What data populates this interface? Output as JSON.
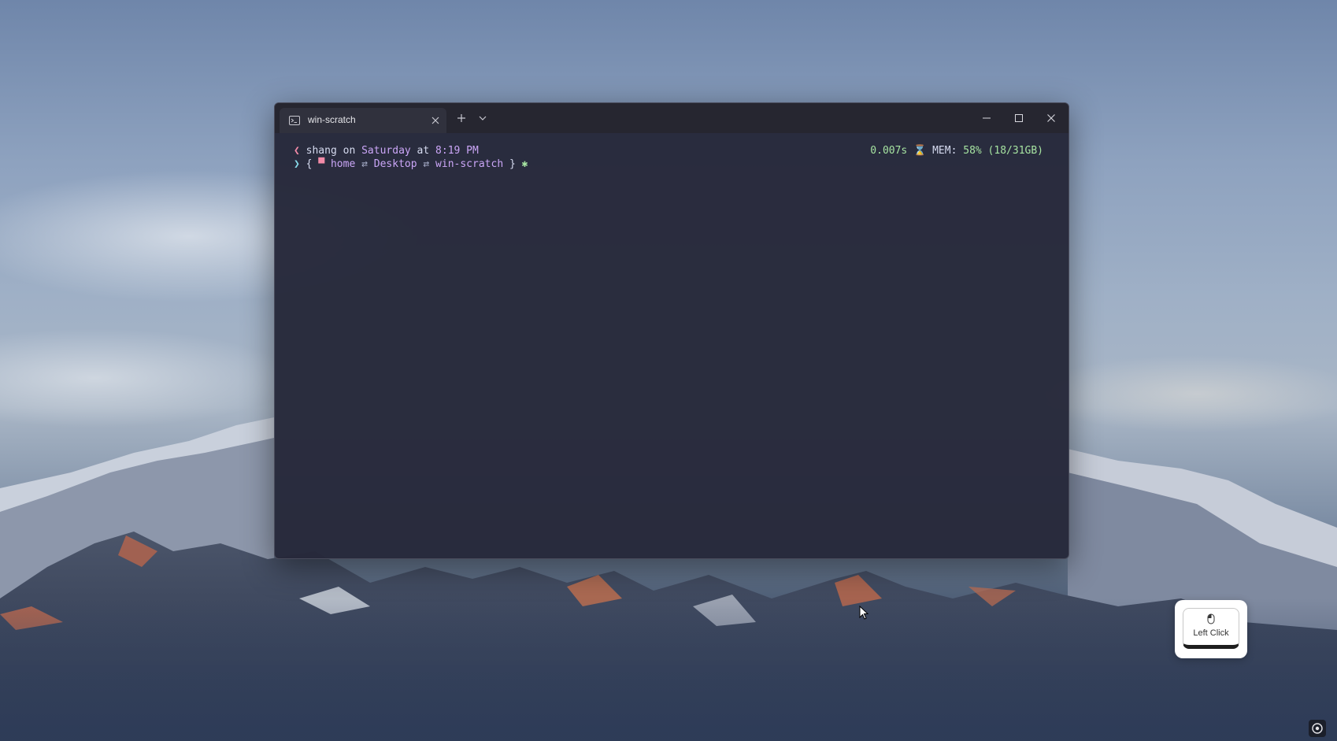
{
  "terminal": {
    "tab_title": "win-scratch",
    "prompt_line1": {
      "user": "shang",
      "on": " on ",
      "day": "Saturday",
      "at": " at ",
      "time": "8:19 PM"
    },
    "prompt_line2": {
      "open": "{ ",
      "folder_glyph": "▀",
      "home": "home",
      "sep1": " ⇄ ",
      "desktop": "Desktop",
      "sep2": " ⇄ ",
      "dir": "win-scratch",
      "close": " }",
      "star": "✱"
    },
    "status": {
      "duration": "0.007s",
      "mem_label": "MEM:",
      "mem_value": "58% (18/31GB)"
    }
  },
  "overlay": {
    "label": "Left Click"
  },
  "colors": {
    "terminal_bg": "#26283a",
    "accent_pink": "#f38ba8",
    "accent_mauve": "#cba6f7",
    "accent_teal": "#89dceb",
    "accent_green": "#a6e3a1"
  },
  "icons": {
    "tab": "terminal-icon",
    "tab_close": "close-icon",
    "new_tab": "plus-icon",
    "dropdown": "chevron-down-icon",
    "minimize": "minimize-icon",
    "maximize": "maximize-icon",
    "close": "close-icon",
    "overlay": "mouse-icon",
    "settings": "settings-icon"
  }
}
